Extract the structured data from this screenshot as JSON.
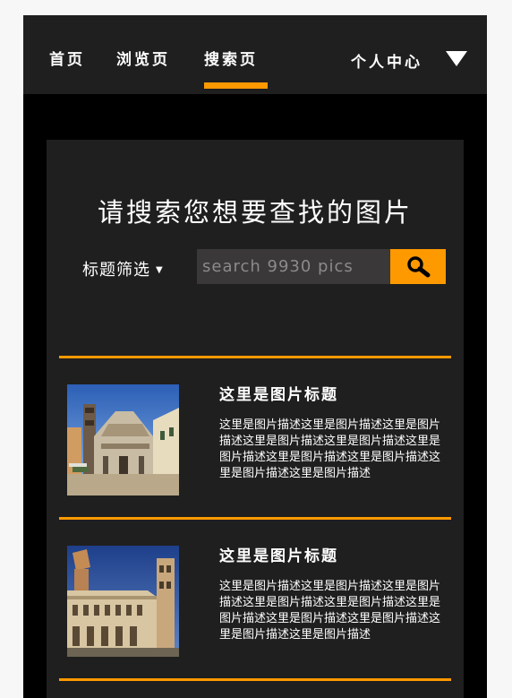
{
  "nav": {
    "items": [
      {
        "label": "首页"
      },
      {
        "label": "浏览页"
      },
      {
        "label": "搜索页"
      }
    ],
    "user_menu_label": "个人中心"
  },
  "search": {
    "title": "请搜索您想要查找的图片",
    "filter_label": "标题筛选",
    "placeholder": "search 9930 pics"
  },
  "results": [
    {
      "title": "这里是图片标题",
      "description": "这里是图片描述这里是图片描述这里是图片描述这里是图片描述这里是图片描述这里是图片描述这里是图片描述这里是图片描述这里是图片描述这里是图片描述"
    },
    {
      "title": "这里是图片标题",
      "description": "这里是图片描述这里是图片描述这里是图片描述这里是图片描述这里是图片描述这里是图片描述这里是图片描述这里是图片描述这里是图片描述这里是图片描述"
    }
  ],
  "colors": {
    "accent": "#ff9900",
    "nav_bg": "#1f1f1f",
    "page_bg": "#000000",
    "input_bg": "#3a3839"
  }
}
